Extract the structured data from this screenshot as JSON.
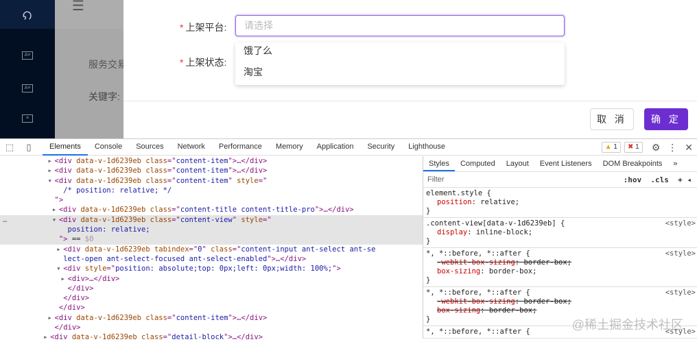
{
  "background": {
    "text1": "服务交易",
    "text2": "关键字:"
  },
  "form": {
    "platform_label": "上架平台:",
    "status_label": "上架状态:",
    "required_mark": "*",
    "platform_placeholder": "请选择",
    "options": [
      "饿了么",
      "淘宝"
    ],
    "cancel": "取 消",
    "ok": "确 定"
  },
  "devtools": {
    "tabs": [
      "Elements",
      "Console",
      "Sources",
      "Network",
      "Performance",
      "Memory",
      "Application",
      "Security",
      "Lighthouse"
    ],
    "warnings": "1",
    "errors": "1",
    "code": [
      {
        "i": 11,
        "e": "▸",
        "s": [
          [
            "t",
            "<div "
          ],
          [
            "a",
            "data-v-1d6239eb "
          ],
          [
            "a",
            "class"
          ],
          [
            "t",
            "=\""
          ],
          [
            "v",
            "content-item"
          ],
          [
            "t",
            "\">…</div>"
          ]
        ]
      },
      {
        "i": 11,
        "e": "▸",
        "s": [
          [
            "t",
            "<div "
          ],
          [
            "a",
            "data-v-1d6239eb "
          ],
          [
            "a",
            "class"
          ],
          [
            "t",
            "=\""
          ],
          [
            "v",
            "content-item"
          ],
          [
            "t",
            "\">…</div>"
          ]
        ]
      },
      {
        "i": 11,
        "e": "▾",
        "s": [
          [
            "t",
            "<div "
          ],
          [
            "a",
            "data-v-1d6239eb "
          ],
          [
            "a",
            "class"
          ],
          [
            "t",
            "=\""
          ],
          [
            "v",
            "content-item"
          ],
          [
            "t",
            "\" "
          ],
          [
            "a",
            "style"
          ],
          [
            "t",
            "=\""
          ]
        ]
      },
      {
        "i": 13,
        "e": "",
        "s": [
          [
            "v",
            "/* position: relative; */"
          ]
        ]
      },
      {
        "i": 11,
        "e": "",
        "s": [
          [
            "t",
            "\">"
          ]
        ]
      },
      {
        "i": 12,
        "e": "▸",
        "s": [
          [
            "t",
            "<div "
          ],
          [
            "a",
            "data-v-1d6239eb "
          ],
          [
            "a",
            "class"
          ],
          [
            "t",
            "=\""
          ],
          [
            "v",
            "content-title content-title-pro"
          ],
          [
            "t",
            "\">…</div>"
          ]
        ]
      },
      {
        "i": 12,
        "e": "▾",
        "sel": true,
        "s": [
          [
            "t",
            "<div "
          ],
          [
            "a",
            "data-v-1d6239eb "
          ],
          [
            "a",
            "class"
          ],
          [
            "t",
            "=\""
          ],
          [
            "v",
            "content-view"
          ],
          [
            "t",
            "\" "
          ],
          [
            "a",
            "style"
          ],
          [
            "t",
            "=\""
          ]
        ]
      },
      {
        "i": 14,
        "e": "",
        "sel": true,
        "s": [
          [
            "v",
            "position: relative;"
          ]
        ]
      },
      {
        "i": 12,
        "e": "",
        "sel": true,
        "s": [
          [
            "t",
            "\"> "
          ],
          [
            "x",
            "== "
          ],
          [
            "p",
            "$0"
          ]
        ]
      },
      {
        "i": 13,
        "e": "▸",
        "s": [
          [
            "t",
            "<div "
          ],
          [
            "a",
            "data-v-1d6239eb tabindex"
          ],
          [
            "t",
            "=\""
          ],
          [
            "v",
            "0"
          ],
          [
            "t",
            "\" "
          ],
          [
            "a",
            "class"
          ],
          [
            "t",
            "=\""
          ],
          [
            "v",
            "content-input ant-select ant-se"
          ]
        ]
      },
      {
        "i": 13,
        "e": "",
        "s": [
          [
            "v",
            "lect-open ant-select-focused ant-select-enabled"
          ],
          [
            "t",
            "\">…</div>"
          ]
        ]
      },
      {
        "i": 13,
        "e": "▾",
        "s": [
          [
            "t",
            "<div "
          ],
          [
            "a",
            "style"
          ],
          [
            "t",
            "=\""
          ],
          [
            "v",
            "position: absolute;top: 0px;left: 0px;width: 100%;"
          ],
          [
            "t",
            "\">"
          ]
        ]
      },
      {
        "i": 14,
        "e": "▸",
        "s": [
          [
            "t",
            "<div>…</div>"
          ]
        ]
      },
      {
        "i": 14,
        "e": "",
        "s": [
          [
            "t",
            "</div>"
          ]
        ]
      },
      {
        "i": 13,
        "e": "",
        "s": [
          [
            "t",
            "</div>"
          ]
        ]
      },
      {
        "i": 12,
        "e": "",
        "s": [
          [
            "t",
            "</div>"
          ]
        ]
      },
      {
        "i": 11,
        "e": "▸",
        "s": [
          [
            "t",
            "<div "
          ],
          [
            "a",
            "data-v-1d6239eb "
          ],
          [
            "a",
            "class"
          ],
          [
            "t",
            "=\""
          ],
          [
            "v",
            "content-item"
          ],
          [
            "t",
            "\">…</div>"
          ]
        ]
      },
      {
        "i": 11,
        "e": "",
        "s": [
          [
            "t",
            "</div>"
          ]
        ]
      },
      {
        "i": 10,
        "e": "▸",
        "s": [
          [
            "t",
            "<div "
          ],
          [
            "a",
            "data-v-1d6239eb "
          ],
          [
            "a",
            "class"
          ],
          [
            "t",
            "=\""
          ],
          [
            "v",
            "detail-block"
          ],
          [
            "t",
            "\">…</div>"
          ]
        ]
      }
    ],
    "styles": {
      "tabs": [
        "Styles",
        "Computed",
        "Layout",
        "Event Listeners",
        "DOM Breakpoints",
        "»"
      ],
      "filter": "Filter",
      "hov": ":hov",
      "cls": ".cls",
      "plus": "+",
      "rules": [
        {
          "sel": "element.style {",
          "src": "",
          "props": [
            {
              "n": "position",
              "v": "relative;",
              "strike": false
            }
          ]
        },
        {
          "sel": ".content-view[data-v-1d6239eb] {",
          "src": "<style>",
          "props": [
            {
              "n": "display",
              "v": "inline-block;",
              "strike": false
            }
          ]
        },
        {
          "sel": "*, *::before, *::after {",
          "src": "<style>",
          "props": [
            {
              "n": "-webkit-box-sizing",
              "v": "border-box;",
              "strike": true
            },
            {
              "n": "box-sizing",
              "v": "border-box;",
              "strike": false
            }
          ]
        },
        {
          "sel": "*, *::before, *::after {",
          "src": "<style>",
          "props": [
            {
              "n": "-webkit-box-sizing",
              "v": "border-box;",
              "strike": true
            },
            {
              "n": "box-sizing",
              "v": "border-box;",
              "strike": true
            }
          ]
        },
        {
          "sel": "*, *::before, *::after {",
          "src": "<style>",
          "props": []
        }
      ],
      "close_brace": "}"
    },
    "watermark": "@稀土掘金技术社区"
  }
}
